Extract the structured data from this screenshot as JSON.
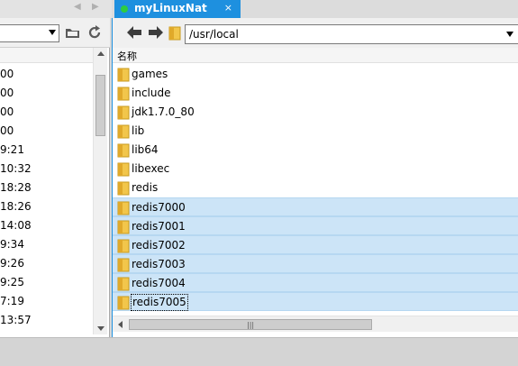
{
  "tab": {
    "title": "myLinuxNat",
    "close_glyph": "×"
  },
  "left_pane": {
    "rows": [
      "00",
      "00",
      "00",
      "00",
      "9:21",
      "10:32",
      "18:28",
      "18:26",
      "14:08",
      "9:34",
      "9:26",
      "9:25",
      "7:19",
      "13:57"
    ]
  },
  "right_pane": {
    "path": "/usr/local",
    "column_name": "名称",
    "files": [
      {
        "name": "games",
        "selected": false
      },
      {
        "name": "include",
        "selected": false
      },
      {
        "name": "jdk1.7.0_80",
        "selected": false
      },
      {
        "name": "lib",
        "selected": false
      },
      {
        "name": "lib64",
        "selected": false
      },
      {
        "name": "libexec",
        "selected": false
      },
      {
        "name": "redis",
        "selected": false
      },
      {
        "name": "redis7000",
        "selected": true
      },
      {
        "name": "redis7001",
        "selected": true
      },
      {
        "name": "redis7002",
        "selected": true
      },
      {
        "name": "redis7003",
        "selected": true
      },
      {
        "name": "redis7004",
        "selected": true
      },
      {
        "name": "redis7005",
        "selected": true,
        "focused": true
      }
    ]
  },
  "icons": {
    "folder": "folder-icon",
    "back": "back-arrow-icon",
    "forward": "forward-arrow-icon",
    "refresh": "refresh-icon",
    "open_folder": "open-folder-icon"
  },
  "colors": {
    "accent": "#1e90df",
    "selection": "#cce4f7",
    "folder": "#f2c64b"
  }
}
